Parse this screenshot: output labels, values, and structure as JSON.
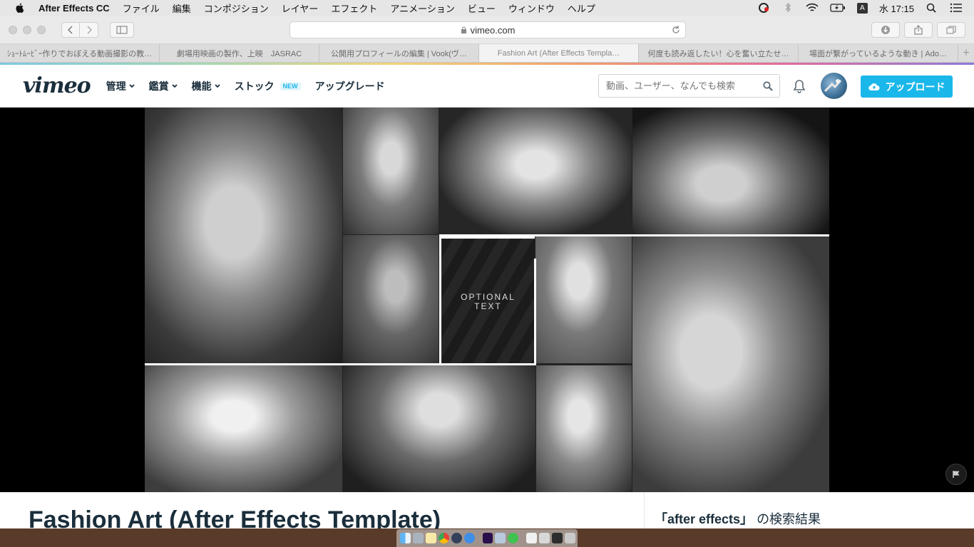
{
  "menubar": {
    "app_name": "After Effects CC",
    "menus": [
      "ファイル",
      "編集",
      "コンポジション",
      "レイヤー",
      "エフェクト",
      "アニメーション",
      "ビュー",
      "ウィンドウ",
      "ヘルプ"
    ],
    "ime_label": "A",
    "clock": "水 17:15"
  },
  "browser": {
    "url": "vimeo.com",
    "tabs": [
      "ｼｮｰﾄﾑｰﾋﾞｰ作りでおぼえる動画撮影の教…",
      "劇場用映画の製作、上映　JASRAC",
      "公開用プロフィールの編集 | Vook(ヴ…",
      "Fashion Art (After Effects Templa…",
      "何度も読み返したい！心を奮い立たせ…",
      "場面が繋がっているような動き | Ado…"
    ],
    "active_tab_index": 3
  },
  "vimeo": {
    "logo": "vimeo",
    "nav": {
      "manage": "管理",
      "watch": "鑑賞",
      "features": "機能",
      "stock": "ストック",
      "stock_badge": "NEW",
      "upgrade": "アップグレード"
    },
    "search_placeholder": "動画、ユーザー、なんでも検索",
    "upload_label": "アップロード"
  },
  "video": {
    "overlay_text_line1": "OPTIONAL",
    "overlay_text_line2": "TEXT",
    "title": "Fashion Art (After Effects Template)"
  },
  "sidebar": {
    "search_term": "「after effects」",
    "search_suffix": "の検索結果"
  },
  "colors": {
    "vimeo_blue": "#1ab7ea",
    "vimeo_dark": "#1a2e3b"
  }
}
